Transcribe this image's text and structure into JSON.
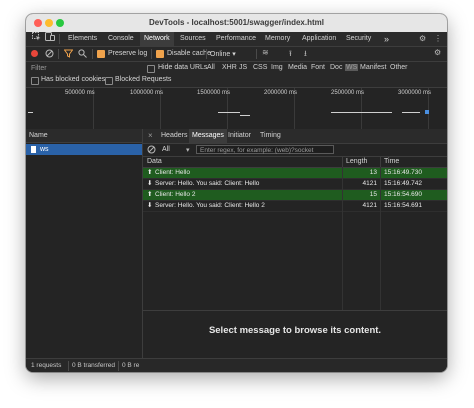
{
  "window": {
    "title": "DevTools - localhost:5001/swagger/index.html",
    "traffic_lights": [
      "#ff5f57",
      "#febc2e",
      "#28c840"
    ]
  },
  "tabs": [
    "Elements",
    "Console",
    "Network",
    "Sources",
    "Performance",
    "Memory",
    "Application",
    "Security"
  ],
  "active_tab": "Network",
  "more_tabs": "»",
  "toolbar": {
    "preserve_log": "Preserve log",
    "disable_cache": "Disable cache",
    "throttle": "Online"
  },
  "filter": {
    "label": "Filter",
    "hide_data_urls": "Hide data URLs",
    "types": [
      "All",
      "XHR",
      "JS",
      "CSS",
      "Img",
      "Media",
      "Font",
      "Doc",
      "WS",
      "Manifest",
      "Other"
    ],
    "active_type": "WS",
    "has_blocked_cookies": "Has blocked cookies",
    "blocked_requests": "Blocked Requests"
  },
  "overview": {
    "ticks": [
      "500000 ms",
      "1000000 ms",
      "1500000 ms",
      "2000000 ms",
      "2500000 ms",
      "3000000 ms"
    ]
  },
  "requests": {
    "column": "Name",
    "items": [
      "ws"
    ]
  },
  "detail": {
    "tabs": [
      "Headers",
      "Messages",
      "Initiator",
      "Timing"
    ],
    "active_tab": "Messages",
    "close": "×",
    "type_filter": "All",
    "regex_placeholder": "Enter regex, for example: (web)?socket",
    "columns": {
      "data": "Data",
      "length": "Length",
      "time": "Time"
    },
    "messages": [
      {
        "direction": "sent",
        "arrow": "⬆",
        "data": "Client: Hello",
        "length": "13",
        "time": "15:16:49.730"
      },
      {
        "direction": "received",
        "arrow": "⬇",
        "data": "Server: Hello. You said: Client: Hello",
        "length": "4121",
        "time": "15:16:49.742"
      },
      {
        "direction": "sent",
        "arrow": "⬆",
        "data": "Client: Hello 2",
        "length": "15",
        "time": "15:16:54.690"
      },
      {
        "direction": "received",
        "arrow": "⬇",
        "data": "Server: Hello. You said: Client: Hello 2",
        "length": "4121",
        "time": "15:16:54.691"
      }
    ],
    "empty_message": "Select message to browse its content."
  },
  "status": {
    "requests": "1 requests",
    "transferred": "0 B transferred",
    "resources": "0 B re"
  },
  "colors": {
    "sent_row": "#1f5c1f",
    "selected_request": "#2a62a8",
    "accent_checkbox": "#f0a34c"
  }
}
